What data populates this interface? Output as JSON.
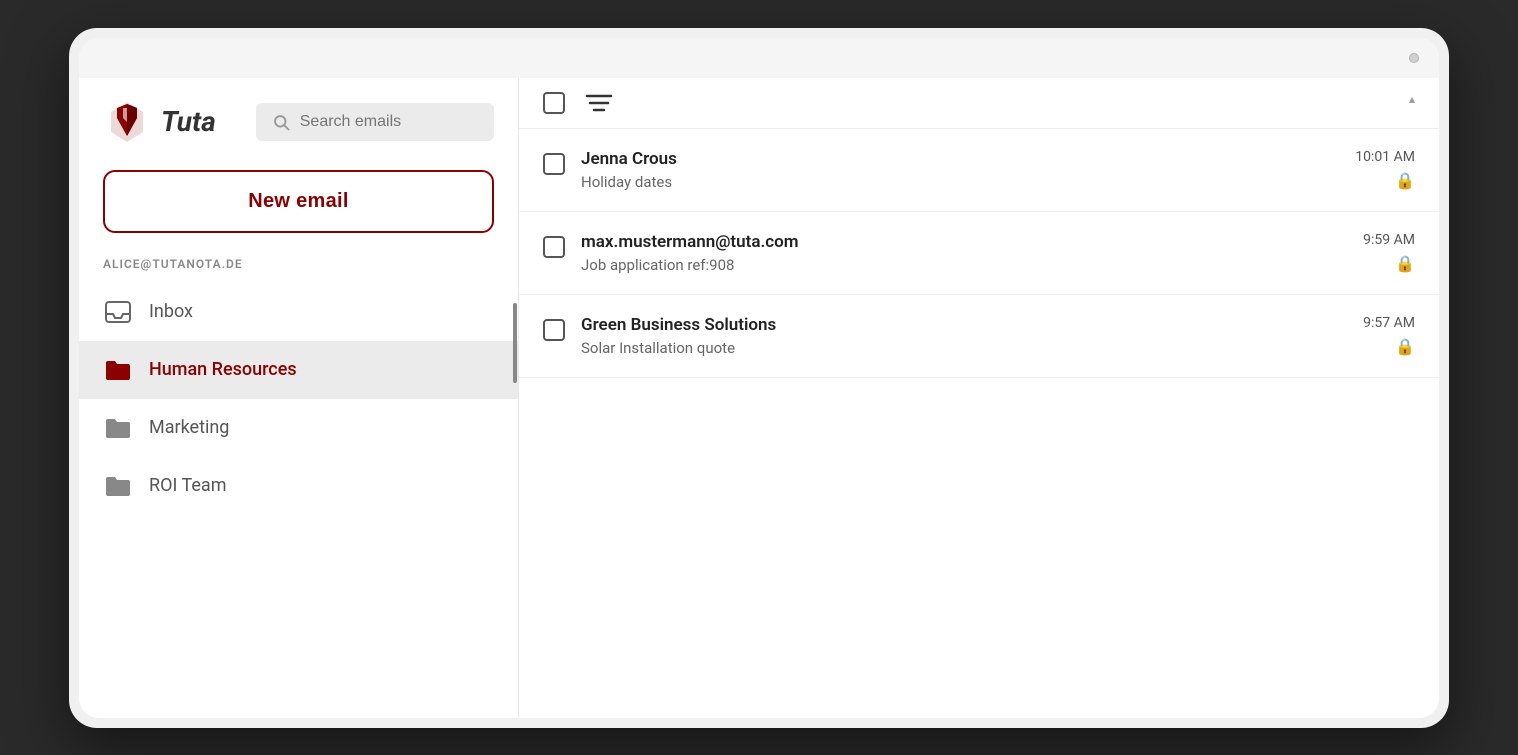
{
  "app": {
    "name": "Tuta",
    "logo_alt": "Tuta logo"
  },
  "top_bar": {
    "camera_dot": true
  },
  "search": {
    "placeholder": "Search emails"
  },
  "compose": {
    "label": "New email"
  },
  "sidebar": {
    "account": "ALICE@TUTANOTA.DE",
    "nav_items": [
      {
        "id": "inbox",
        "label": "Inbox",
        "icon": "inbox-icon",
        "active": false
      },
      {
        "id": "human-resources",
        "label": "Human Resources",
        "icon": "folder-icon-red",
        "active": true
      },
      {
        "id": "marketing",
        "label": "Marketing",
        "icon": "folder-icon-gray",
        "active": false
      },
      {
        "id": "roi-team",
        "label": "ROI Team",
        "icon": "folder-icon-gray",
        "active": false
      }
    ]
  },
  "email_list": {
    "header": {
      "select_all_label": "",
      "filter_label": "",
      "sort_indicator": "▴"
    },
    "emails": [
      {
        "id": 1,
        "sender": "Jenna Crous",
        "subject": "Holiday dates",
        "time": "10:01 AM",
        "encrypted": true
      },
      {
        "id": 2,
        "sender": "max.mustermann@tuta.com",
        "subject": "Job application ref:908",
        "time": "9:59 AM",
        "encrypted": true
      },
      {
        "id": 3,
        "sender": "Green Business Solutions",
        "subject": "Solar Installation quote",
        "time": "9:57 AM",
        "encrypted": true
      }
    ]
  },
  "colors": {
    "brand_red": "#8b0000",
    "active_bg": "#ebebeb"
  }
}
